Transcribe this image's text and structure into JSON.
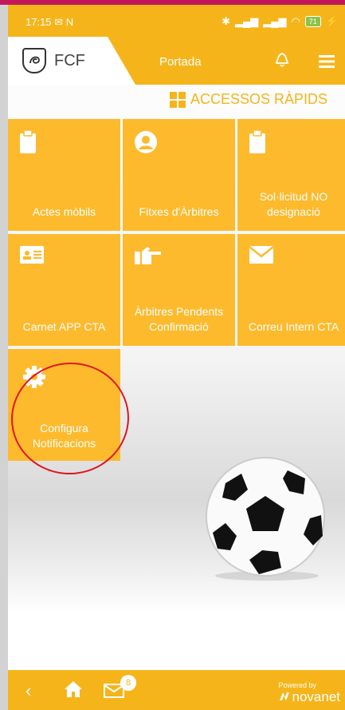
{
  "status_bar": {
    "time": "17:15",
    "notif_letter": "N",
    "battery": "71"
  },
  "app_bar": {
    "logo_text": "FCF",
    "title": "Portada",
    "logo_icon": "fcf-crest-icon",
    "bell_icon": "bell-icon",
    "menu_icon": "hamburger-menu-icon"
  },
  "quick_access": {
    "title": "ACCESSOS RÀPIDS",
    "icon": "grid-icon"
  },
  "tiles": [
    {
      "label": "Actes mòbils",
      "icon": "clipboard-icon"
    },
    {
      "label": "Fitxes d'Àrbitres",
      "icon": "user-circle-icon"
    },
    {
      "label": "Sol·licitud NO designació",
      "icon": "clipboard-icon"
    },
    {
      "label": "Carnet APP CTA",
      "icon": "id-card-icon"
    },
    {
      "label": "Àrbitres Pendents Confirmació",
      "icon": "hand-pointing-icon"
    },
    {
      "label": "Correu Intern CTA",
      "icon": "envelope-icon"
    },
    {
      "label": "Configura Notificacions",
      "icon": "gear-icon"
    }
  ],
  "bottom_bar": {
    "mail_badge": "8",
    "powered_by": "Powered by",
    "brand": "novanet"
  },
  "colors": {
    "accent": "#f5b51a",
    "tile": "#fdba2d",
    "annotation": "#e0161e"
  }
}
